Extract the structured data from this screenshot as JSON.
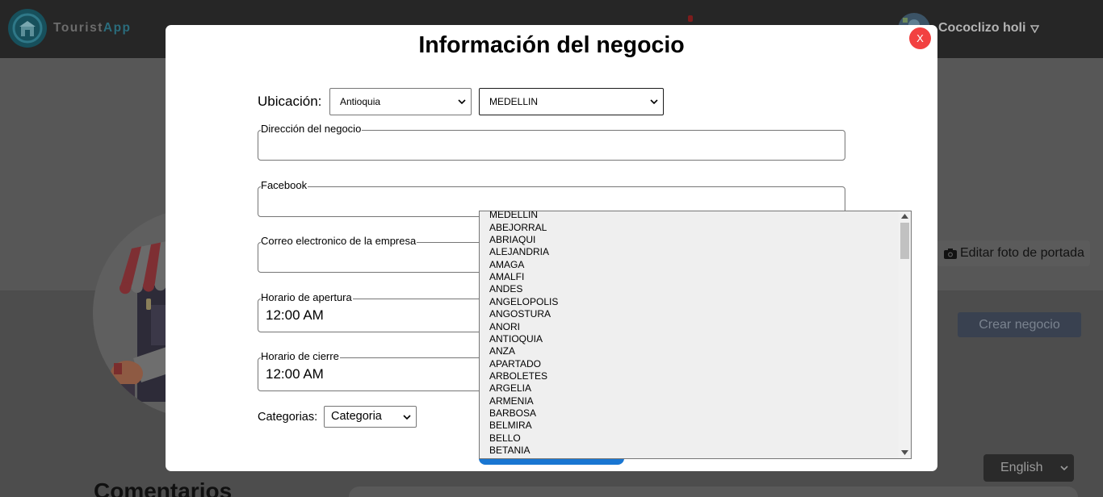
{
  "header": {
    "logo_icon": "shop-logo-icon",
    "app_name": {
      "part1": "Tourist",
      "part2": "App"
    },
    "notification_icon": "notification-dot-icon",
    "user": {
      "name": "Cococlizo holi",
      "avatar_icon": "user-avatar-icon",
      "menu_icon": "triangle-down-outline-icon"
    }
  },
  "profile": {
    "illustration": "shop-illustration",
    "edit_cover": {
      "label": "Editar foto de portada",
      "icon": "camera-icon"
    },
    "create_business": {
      "label": "Crear negocio"
    },
    "comments": {
      "heading": "Comentarios"
    }
  },
  "language_select": {
    "selected": "English",
    "icon": "chevron-down-icon"
  },
  "modal": {
    "title": "Información del negocio",
    "close_label": "X",
    "location": {
      "label": "Ubicación:",
      "department": {
        "selected": "Antioquia"
      },
      "city": {
        "selected": "MEDELLIN",
        "dropdown_open": true,
        "options": [
          "MEDELLIN",
          "ABEJORRAL",
          "ABRIAQUI",
          "ALEJANDRIA",
          "AMAGA",
          "AMALFI",
          "ANDES",
          "ANGELOPOLIS",
          "ANGOSTURA",
          "ANORI",
          "ANTIOQUIA",
          "ANZA",
          "APARTADO",
          "ARBOLETES",
          "ARGELIA",
          "ARMENIA",
          "BARBOSA",
          "BELMIRA",
          "BELLO",
          "BETANIA"
        ]
      }
    },
    "fields": {
      "address": {
        "label": "Dirección del negocio",
        "value": ""
      },
      "facebook": {
        "label": "Facebook",
        "value": ""
      },
      "email": {
        "label": "Correo electronico de la empresa",
        "value": ""
      },
      "opening_hours": {
        "label": "Horario de apertura",
        "value": "12:00 AM"
      },
      "closing_hours": {
        "label": "Horario de cierre",
        "value": "12:00 AM"
      }
    },
    "categories": {
      "label": "Categorias:",
      "selected": "Categoria"
    }
  },
  "colors": {
    "header_bg": "#262626",
    "brand_teal": "#2a6c7c",
    "modal_bg": "#ffffff",
    "close_button": "#f24141",
    "primary_button": "#1976d2",
    "dropdown_bg": "#efefef",
    "create_button": "#394150"
  }
}
